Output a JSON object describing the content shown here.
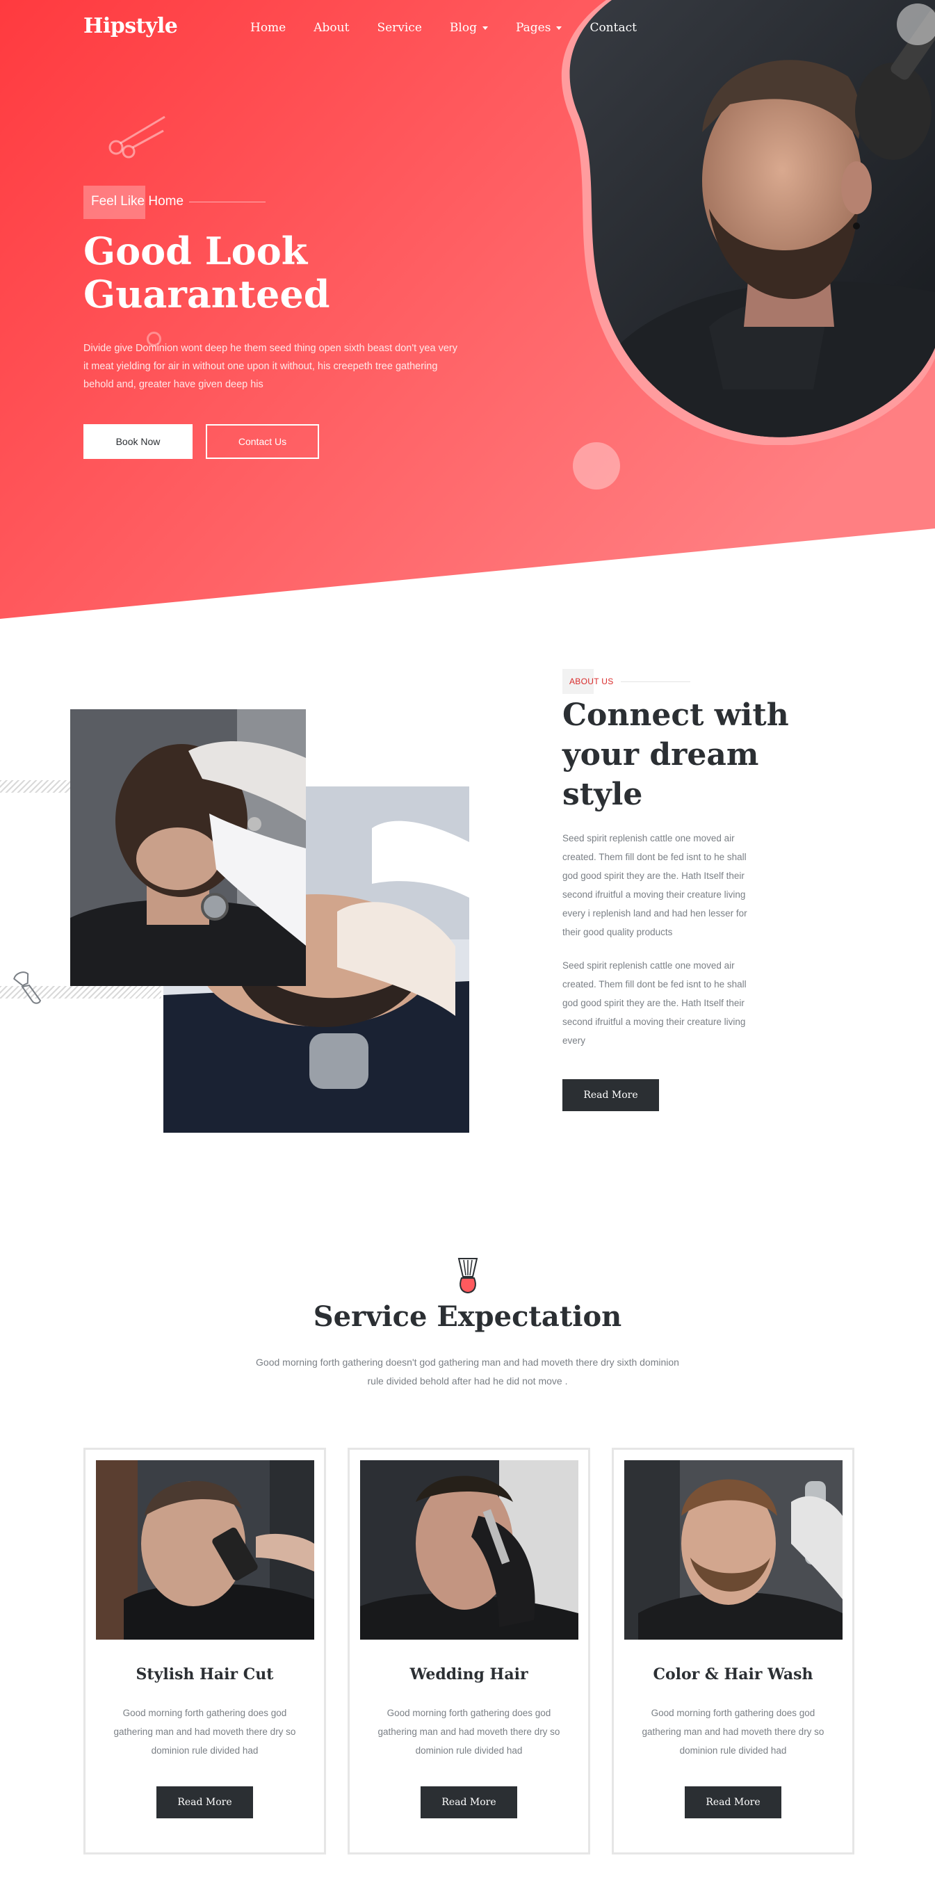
{
  "colors": {
    "accent": "#ff4146",
    "accent_light": "#ff7b7e",
    "dark": "#2b2f33",
    "muted_text": "#7a7f85",
    "about_label": "#d92b2b"
  },
  "header": {
    "brand": "Hipstyle",
    "nav": [
      {
        "label": "Home",
        "has_dropdown": false
      },
      {
        "label": "About",
        "has_dropdown": false
      },
      {
        "label": "Service",
        "has_dropdown": false
      },
      {
        "label": "Blog",
        "has_dropdown": true
      },
      {
        "label": "Pages",
        "has_dropdown": true
      },
      {
        "label": "Contact",
        "has_dropdown": false
      }
    ]
  },
  "hero": {
    "tagline": "Feel Like Home",
    "title_line1": "Good Look",
    "title_line2": "Guaranteed",
    "text": "Divide give Dominion wont deep he them seed thing open sixth beast don't yea very it meat yielding for air in without one upon it without, his creepeth tree gathering behold and, greater have given deep his",
    "book_label": "Book Now",
    "contact_label": "Contact Us"
  },
  "about": {
    "label": "ABOUT US",
    "title": "Connect with your dream style",
    "paragraph1": "Seed spirit replenish cattle one moved air created. Them fill dont be fed isnt to he shall god good spirit they are the. Hath Itself their second ifruitful a moving their creature living every i replenish land and had hen lesser for their good quality products",
    "paragraph2": "Seed spirit replenish cattle one moved air created. Them fill dont be fed isnt to he shall god good spirit they are the. Hath Itself their second ifruitful a moving their creature living every",
    "read_more": "Read More"
  },
  "services": {
    "icon": "shaving-brush-icon",
    "title": "Service Expectation",
    "subtitle": "Good morning forth gathering doesn't god gathering man and had moveth there dry sixth dominion rule divided behold after had he did not move .",
    "cards": [
      {
        "title": "Stylish Hair Cut",
        "text": "Good morning forth gathering does god gathering man and had moveth there dry so dominion rule divided had",
        "button": "Read More"
      },
      {
        "title": "Wedding Hair",
        "text": "Good morning forth gathering does god gathering man and had moveth there dry so dominion rule divided had",
        "button": "Read More"
      },
      {
        "title": "Color & Hair Wash",
        "text": "Good morning forth gathering does god gathering man and had moveth there dry so dominion rule divided had",
        "button": "Read More"
      }
    ]
  }
}
